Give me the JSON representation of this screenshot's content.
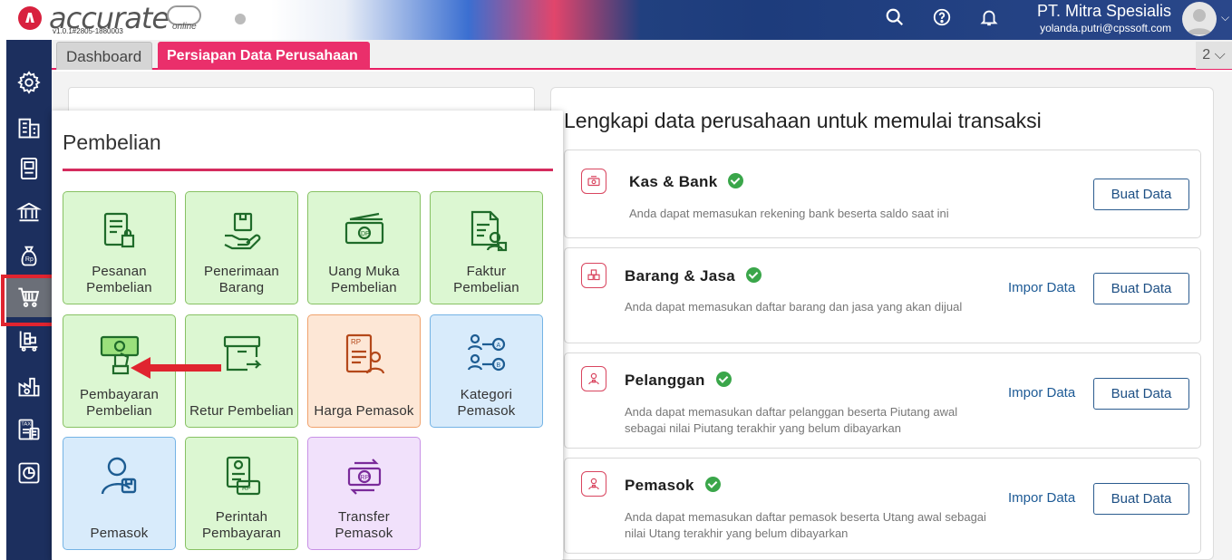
{
  "header": {
    "logo_text": "accurate",
    "logo_online": "online",
    "version": "v1.0.1#2805-1880003",
    "company_name": "PT. Mitra Spesialis",
    "user_email": "yolanda.putri@cpssoft.com",
    "icons": [
      "search-icon",
      "help-icon",
      "bell-icon",
      "avatar",
      "chevron-down-icon"
    ]
  },
  "tabs": {
    "dashboard": "Dashboard",
    "persiapan": "Persiapan Data Perusahaan",
    "count": "2 ⌵"
  },
  "sidebar": {
    "items": [
      "gear-icon",
      "building-icon",
      "ledger-icon",
      "bank-icon",
      "money-bag-icon",
      "cart-icon",
      "inventory-cart-icon",
      "factory-icon",
      "tax-report-icon",
      "chart-report-icon"
    ],
    "active": "cart-icon"
  },
  "popup": {
    "title": "Pembelian",
    "tiles": [
      {
        "label": "Pesanan\nPembelian",
        "icon": "purchase-order-icon",
        "color": "green"
      },
      {
        "label": "Penerimaan\nBarang",
        "icon": "receive-goods-icon",
        "color": "green"
      },
      {
        "label": "Uang Muka\nPembelian",
        "icon": "cash-advance-icon",
        "color": "green"
      },
      {
        "label": "Faktur\nPembelian",
        "icon": "invoice-icon",
        "color": "green"
      },
      {
        "label": "Pembayaran\nPembelian",
        "icon": "payment-icon",
        "color": "green"
      },
      {
        "label": "Retur Pembelian",
        "icon": "return-box-icon",
        "color": "green"
      },
      {
        "label": "Harga Pemasok",
        "icon": "price-list-icon",
        "color": "orange"
      },
      {
        "label": "Kategori\nPemasok",
        "icon": "category-icon",
        "color": "blue"
      },
      {
        "label": "Pemasok",
        "icon": "supplier-icon",
        "color": "blue"
      },
      {
        "label": "Perintah\nPembayaran",
        "icon": "payment-order-icon",
        "color": "green"
      },
      {
        "label": "Transfer\nPemasok",
        "icon": "transfer-icon",
        "color": "purple"
      }
    ]
  },
  "main": {
    "title": "Lengkapi data perusahaan untuk memulai transaksi",
    "items": [
      {
        "title": "Kas & Bank",
        "desc": "Anda dapat memasukan rekening bank beserta saldo saat ini",
        "button": "Buat Data",
        "impor": ""
      },
      {
        "title": "Barang & Jasa",
        "desc": "Anda dapat memasukan daftar barang dan jasa yang akan dijual",
        "button": "Buat Data",
        "impor": "Impor Data"
      },
      {
        "title": "Pelanggan",
        "desc": "Anda dapat memasukan daftar pelanggan beserta Piutang awal sebagai nilai Piutang terakhir yang belum dibayarkan",
        "button": "Buat Data",
        "impor": "Impor Data"
      },
      {
        "title": "Pemasok",
        "desc": "Anda dapat memasukan daftar pemasok beserta Utang awal sebagai nilai Utang terakhir yang belum dibayarkan",
        "button": "Buat Data",
        "impor": "Impor Data"
      }
    ]
  },
  "colors": {
    "accent_pink": "#e91e63",
    "sidebar": "#1c2f5e",
    "tile_green": "#dcf7d2",
    "highlight_red": "#e0242f",
    "check_green": "#3aa64a"
  }
}
